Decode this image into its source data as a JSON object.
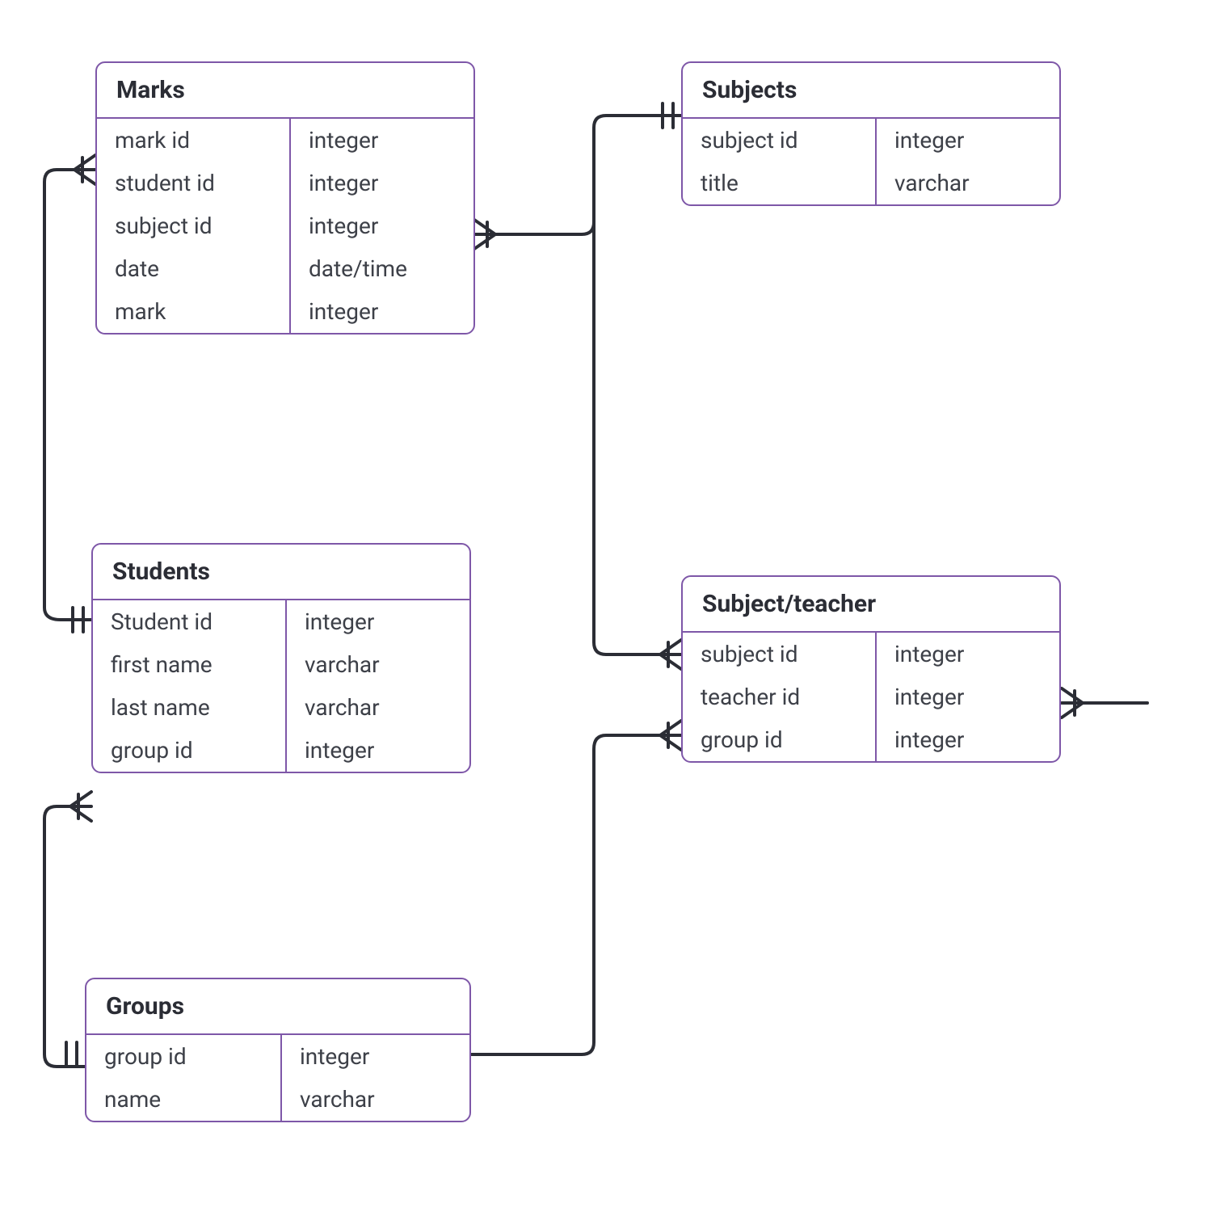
{
  "entities": {
    "marks": {
      "title": "Marks",
      "fields": [
        {
          "name": "mark id",
          "type": "integer"
        },
        {
          "name": "student id",
          "type": "integer"
        },
        {
          "name": "subject id",
          "type": "integer"
        },
        {
          "name": "date",
          "type": "date/time"
        },
        {
          "name": "mark",
          "type": "integer"
        }
      ]
    },
    "subjects": {
      "title": "Subjects",
      "fields": [
        {
          "name": "subject id",
          "type": "integer"
        },
        {
          "name": "title",
          "type": "varchar"
        }
      ]
    },
    "students": {
      "title": "Students",
      "fields": [
        {
          "name": "Student id",
          "type": "integer"
        },
        {
          "name": "first name",
          "type": "varchar"
        },
        {
          "name": "last name",
          "type": "varchar"
        },
        {
          "name": "group id",
          "type": "integer"
        }
      ]
    },
    "subject_teacher": {
      "title": "Subject/teacher",
      "fields": [
        {
          "name": "subject id",
          "type": "integer"
        },
        {
          "name": "teacher id",
          "type": "integer"
        },
        {
          "name": "group id",
          "type": "integer"
        }
      ]
    },
    "groups": {
      "title": "Groups",
      "fields": [
        {
          "name": "group id",
          "type": "integer"
        },
        {
          "name": "name",
          "type": "varchar"
        }
      ]
    }
  },
  "relationships": [
    {
      "from": "marks",
      "to": "students",
      "from_card": "many",
      "to_card": "one"
    },
    {
      "from": "marks",
      "to": "subjects",
      "from_card": "many",
      "to_card": "one"
    },
    {
      "from": "subject_teacher",
      "to": "subjects",
      "from_card": "many",
      "to_card": "one"
    },
    {
      "from": "subject_teacher",
      "to": "groups",
      "from_card": "many",
      "to_card": "one"
    },
    {
      "from": "subject_teacher",
      "to": "teachers_offscreen",
      "from_card": "many",
      "to_card": "one"
    },
    {
      "from": "students",
      "to": "groups",
      "from_card": "many",
      "to_card": "one"
    }
  ],
  "colors": {
    "entity_border": "#7e57a8",
    "text_header": "#2b2d35",
    "text_body": "#3d4048",
    "connector": "#2b2d35"
  }
}
